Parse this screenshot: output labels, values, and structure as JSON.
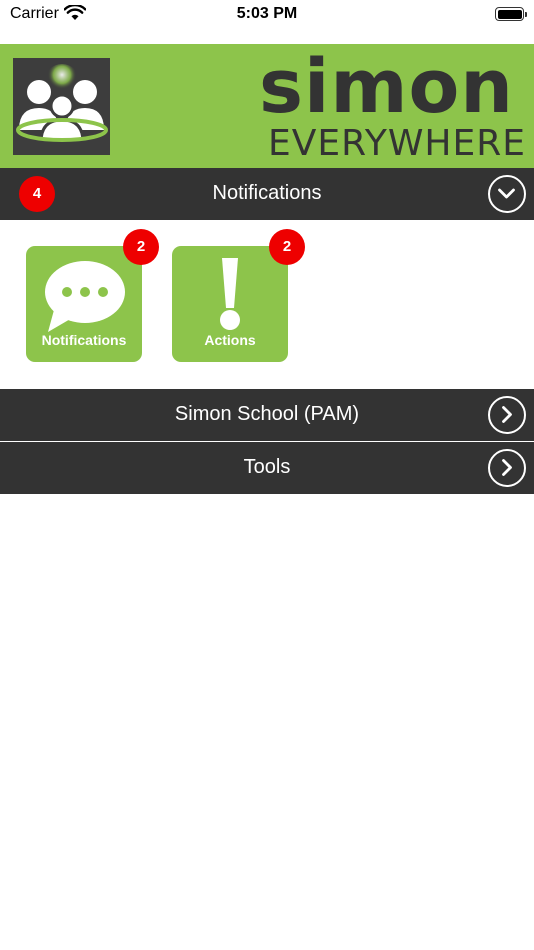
{
  "status_bar": {
    "carrier": "Carrier",
    "time": "5:03 PM"
  },
  "header": {
    "brand_name": "simon",
    "brand_subtitle": "EVERYWHERE",
    "brand_color": "#8dc44b"
  },
  "sections": [
    {
      "title": "Notifications",
      "badge": "4",
      "expanded": true,
      "chevron": "chevron-down-icon"
    },
    {
      "title": "Simon School (PAM)",
      "expanded": false,
      "chevron": "chevron-right-icon"
    },
    {
      "title": "Tools",
      "expanded": false,
      "chevron": "chevron-right-icon"
    }
  ],
  "tiles": [
    {
      "label": "Notifications",
      "badge": "2",
      "icon": "speech-bubble-icon"
    },
    {
      "label": "Actions",
      "badge": "2",
      "icon": "exclamation-icon"
    }
  ],
  "colors": {
    "section_bar": "#333333",
    "badge": "#ee0000",
    "tile": "#8dc44b"
  }
}
